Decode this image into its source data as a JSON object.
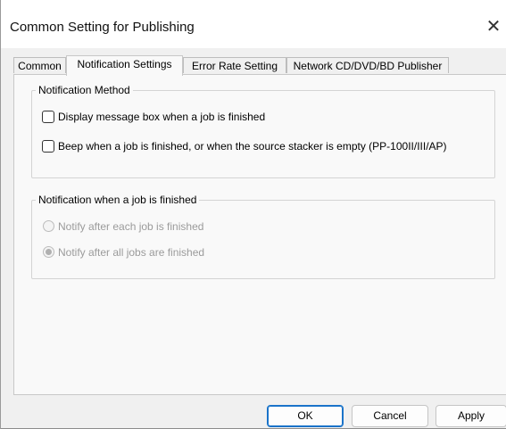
{
  "window": {
    "title": "Common Setting for Publishing",
    "close_glyph": "✕"
  },
  "tabs": [
    {
      "label": "Common",
      "active": false
    },
    {
      "label": "Notification Settings",
      "active": true
    },
    {
      "label": "Error Rate Setting",
      "active": false
    },
    {
      "label": "Network CD/DVD/BD Publisher",
      "active": false
    }
  ],
  "notification_method": {
    "legend": "Notification Method",
    "options": [
      {
        "label": "Display message box when a job is finished",
        "checked": false
      },
      {
        "label": "Beep when a job is finished, or when the source stacker is empty (PP-100II/III/AP)",
        "checked": false
      }
    ]
  },
  "notification_finished": {
    "legend": "Notification when a job is finished",
    "enabled": false,
    "options": [
      {
        "label": "Notify after each job is finished",
        "selected": false
      },
      {
        "label": "Notify after all jobs are finished",
        "selected": true
      }
    ]
  },
  "buttons": {
    "ok": "OK",
    "cancel": "Cancel",
    "apply": "Apply"
  }
}
